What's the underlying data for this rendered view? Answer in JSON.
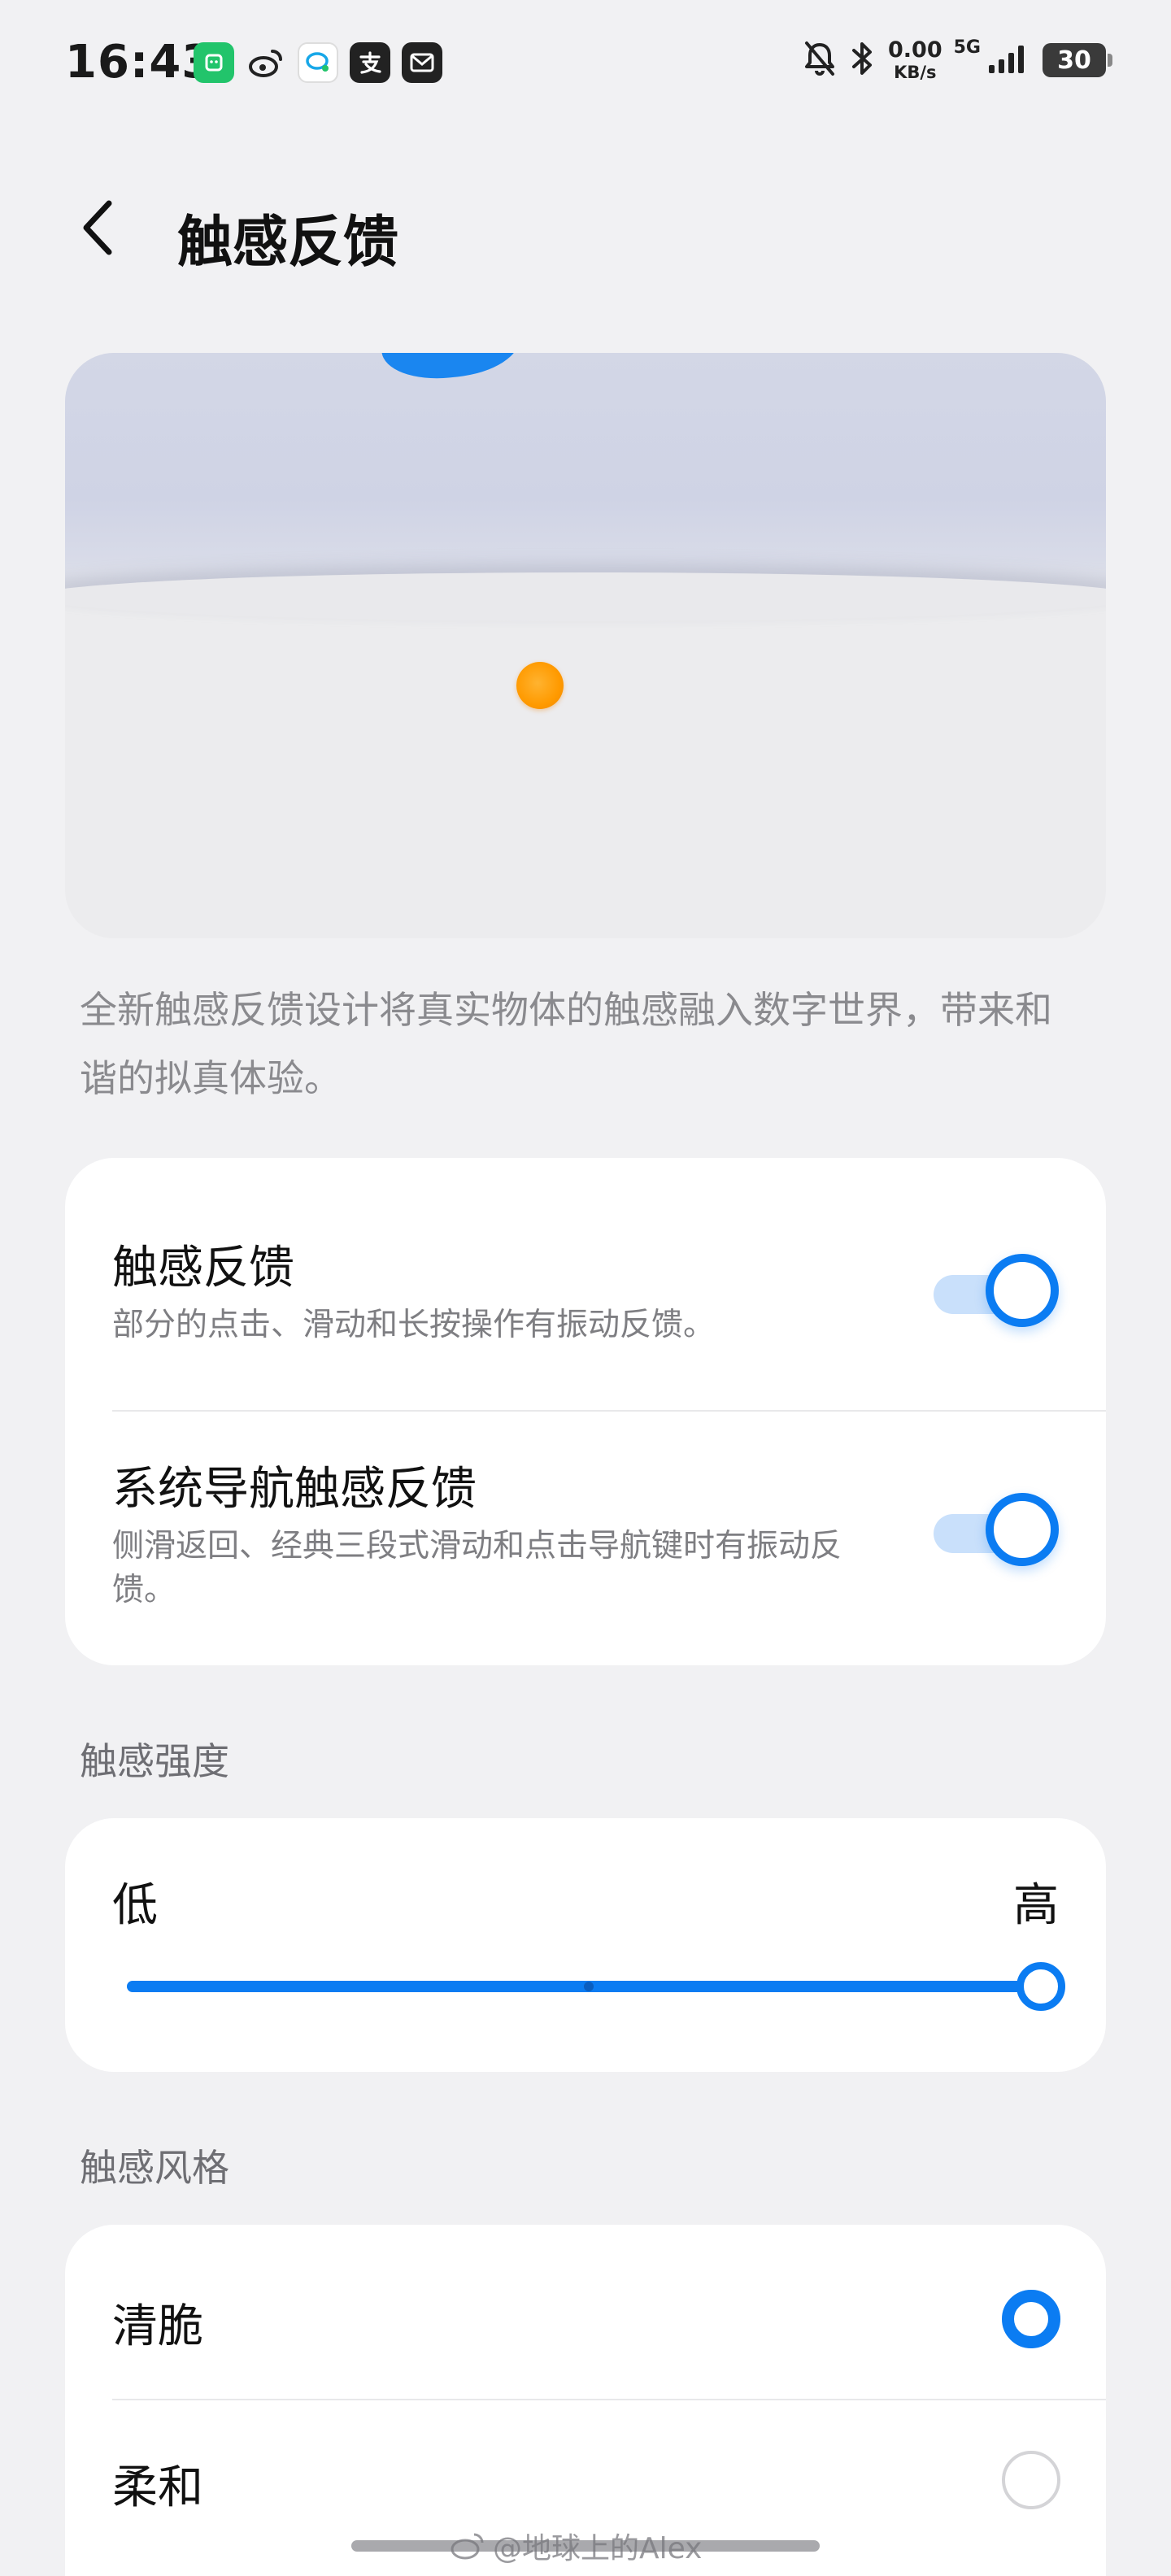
{
  "status_bar": {
    "time": "16:43",
    "net_speed_value": "0.00",
    "net_speed_unit": "KB/s",
    "network_type": "5G",
    "battery": "30"
  },
  "header": {
    "title": "触感反馈"
  },
  "description": "全新触感反馈设计将真实物体的触感融入数字世界，带来和谐的拟真体验。",
  "toggles": [
    {
      "title": "触感反馈",
      "subtitle": "部分的点击、滑动和长按操作有振动反馈。",
      "on": true
    },
    {
      "title": "系统导航触感反馈",
      "subtitle": "侧滑返回、经典三段式滑动和点击导航键时有振动反馈。",
      "on": true
    }
  ],
  "intensity": {
    "section_label": "触感强度",
    "low_label": "低",
    "high_label": "高",
    "level": 1.0
  },
  "style": {
    "section_label": "触感风格",
    "options": [
      {
        "label": "清脆",
        "selected": true
      },
      {
        "label": "柔和",
        "selected": false
      }
    ]
  },
  "watermark": "@地球上的Alex",
  "colors": {
    "accent": "#0b7cf2",
    "background": "#f1f1f3",
    "card": "#ffffff"
  }
}
